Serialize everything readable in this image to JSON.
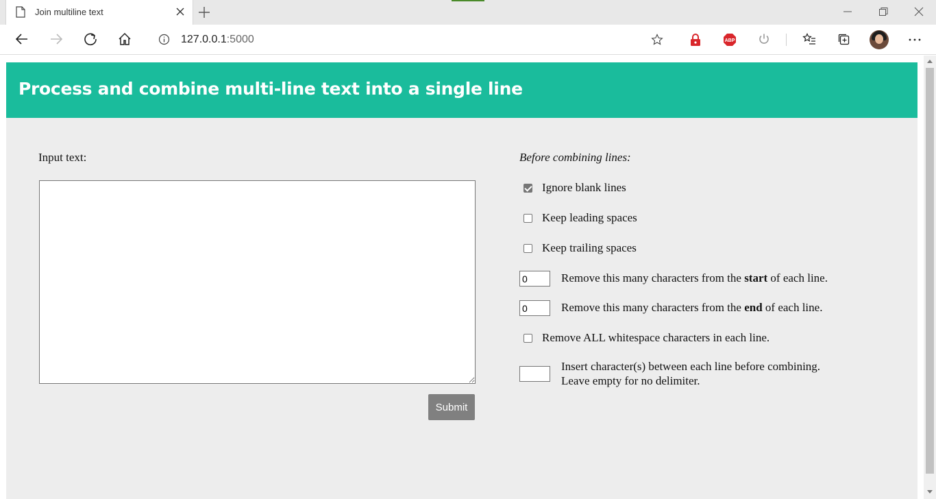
{
  "browser": {
    "tab_title": "Join multiline text",
    "url_host": "127.0.0.1",
    "url_port": ":5000"
  },
  "page": {
    "heading": "Process and combine multi-line text into a single line",
    "input_label": "Input text:",
    "input_value": "",
    "submit_label": "Submit",
    "options_title": "Before combining lines:",
    "options": {
      "ignore_blank": {
        "label": "Ignore blank lines",
        "checked": true
      },
      "keep_leading": {
        "label": "Keep leading spaces",
        "checked": false
      },
      "keep_trailing": {
        "label": "Keep trailing spaces",
        "checked": false
      },
      "remove_start": {
        "value": "0",
        "pre": "Remove this many characters from the ",
        "bold": "start",
        "post": " of each line."
      },
      "remove_end": {
        "value": "0",
        "pre": "Remove this many characters from the ",
        "bold": "end",
        "post": " of each line."
      },
      "remove_ws": {
        "label": "Remove ALL whitespace characters in each line.",
        "checked": false
      },
      "delimiter": {
        "value": "",
        "line1": "Insert character(s) between each line before combining.",
        "line2": "Leave empty for no delimiter."
      }
    }
  },
  "colors": {
    "header_bg": "#1abc9c",
    "panel_bg": "#ededed",
    "submit_bg": "#808080"
  },
  "icons": {
    "tab": "document-icon",
    "close": "close-icon",
    "new_tab": "plus-icon",
    "back": "back-arrow-icon",
    "forward": "forward-arrow-icon",
    "refresh": "refresh-icon",
    "home": "home-icon",
    "info": "info-icon",
    "favorite": "star-icon",
    "lock_ext": "lock-extension-icon",
    "adblock": "adblock-plus-icon",
    "power": "power-icon",
    "favorites": "favorites-list-icon",
    "collections": "collections-icon",
    "profile": "profile-avatar",
    "menu": "more-menu-icon"
  }
}
